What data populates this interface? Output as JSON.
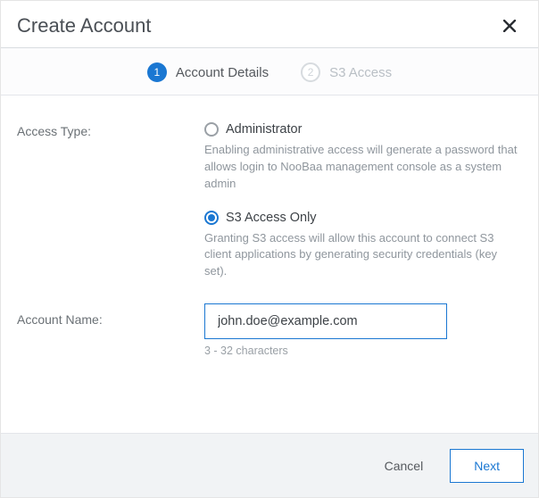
{
  "title": "Create Account",
  "stepper": {
    "steps": [
      {
        "num": "1",
        "label": "Account Details",
        "state": "active"
      },
      {
        "num": "2",
        "label": "S3 Access",
        "state": "inactive"
      }
    ]
  },
  "form": {
    "access_type": {
      "label": "Access Type:",
      "options": {
        "admin": {
          "label": "Administrator",
          "desc": "Enabling administrative access will generate a password that allows login to NooBaa management console as a system admin",
          "selected": false
        },
        "s3": {
          "label": "S3 Access Only",
          "desc": "Granting S3 access will allow this account to connect S3 client applications by generating security credentials (key set).",
          "selected": true
        }
      }
    },
    "account_name": {
      "label": "Account Name:",
      "value": "john.doe@example.com",
      "hint": "3 - 32 characters"
    }
  },
  "footer": {
    "cancel": "Cancel",
    "next": "Next"
  }
}
